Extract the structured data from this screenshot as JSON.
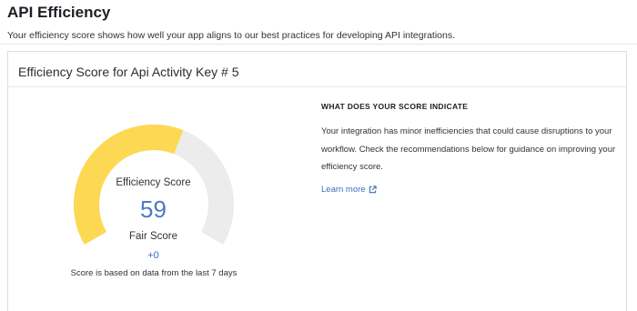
{
  "header": {
    "title": "API Efficiency",
    "subtitle": "Your efficiency score shows how well your app aligns to our best practices for developing API integrations."
  },
  "card": {
    "title": "Efficiency Score for Api Activity Key # 5"
  },
  "gauge": {
    "caption": "Efficiency Score",
    "score": "59",
    "score_value": 59,
    "max_value": 100,
    "rating": "Fair Score",
    "delta": "+0",
    "note": "Score is based on data from the last 7 days",
    "colors": {
      "filled": "#fdd853",
      "track": "#ececec"
    }
  },
  "info": {
    "heading": "WHAT DOES YOUR SCORE INDICATE",
    "body": "Your integration has minor inefficiencies that could cause disruptions to your workflow. Check the recommendations below for guidance on improving your efficiency score.",
    "learn_more": "Learn more",
    "learn_more_icon": "external-link-icon",
    "accent": "#3a6fb7"
  }
}
